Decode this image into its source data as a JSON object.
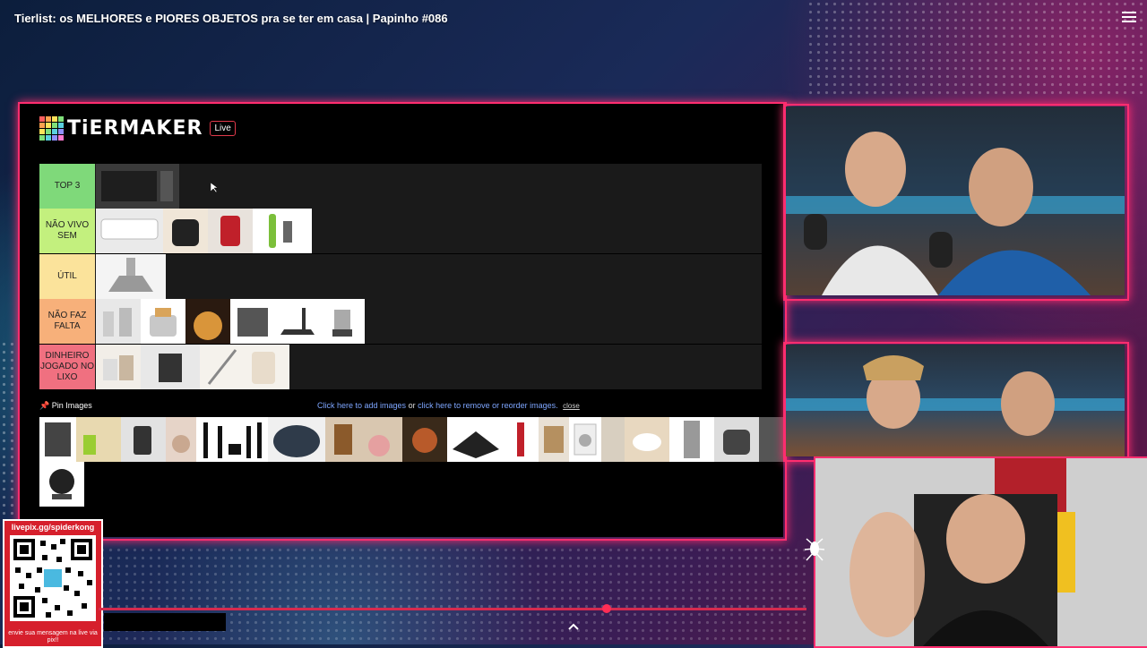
{
  "video": {
    "title": "Tierlist: os MELHORES e PIORES OBJETOS pra se ter em casa | Papinho #086",
    "queue_icon": "playlist-icon"
  },
  "tiermaker": {
    "logo": "TiERMAKER",
    "badge": "Live",
    "tiers": [
      {
        "label": "TOP 3",
        "color": "#7fd97a"
      },
      {
        "label": "NÃO VIVO SEM",
        "color": "#c3f07e"
      },
      {
        "label": "ÚTIL",
        "color": "#fbe39b"
      },
      {
        "label": "NÃO FAZ FALTA",
        "color": "#f7b07a"
      },
      {
        "label": "DINHEIRO JOGADO NO LIXO",
        "color": "#f07080"
      }
    ],
    "pin_label": "Pin Images",
    "add_link": "Click here to add images",
    "or_text": " or ",
    "reorder_link": "click here to remove or reorder images.",
    "close_link": "close"
  },
  "overlay": {
    "qr_top": "livepix.gg/spiderkong",
    "qr_bottom": "envie sua mensagem na live via pix!!"
  },
  "colors": {
    "accent": "#ff2d6f",
    "tier_bg": "#1a1a1a"
  }
}
